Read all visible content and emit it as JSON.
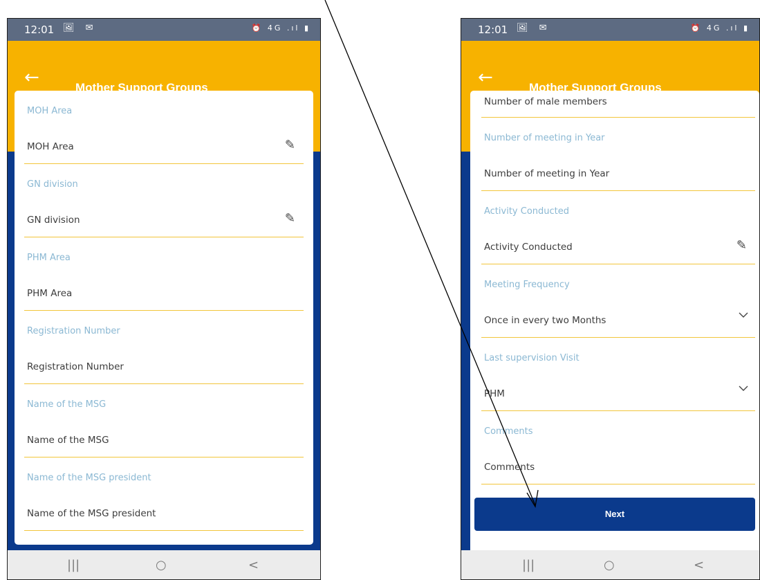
{
  "status": {
    "time": "12:01",
    "icons": "🖼 ✉",
    "sys": "⏰ 4G .ıl ▮"
  },
  "app": {
    "title": "Mother Support Groups",
    "back_glyph": "←"
  },
  "left_fields": [
    {
      "label": "MOH Area",
      "value": "MOH Area",
      "edit": true
    },
    {
      "label": "GN division",
      "value": "GN division",
      "edit": true
    },
    {
      "label": "PHM Area",
      "value": "PHM Area"
    },
    {
      "label": "Registration Number",
      "value": "Registration Number"
    },
    {
      "label": "Name of the MSG",
      "value": "Name of the MSG"
    },
    {
      "label": "Name of the MSG president",
      "value": "Name of the MSG president"
    }
  ],
  "right_fields": {
    "top_value": "Number of male members",
    "items": [
      {
        "label": "Number of meeting in Year",
        "value": "Number of meeting in Year"
      },
      {
        "label": "Activity Conducted",
        "value": "Activity Conducted",
        "edit": true
      },
      {
        "label": "Meeting Frequency",
        "value": "Once in every two Months",
        "dropdown": true
      },
      {
        "label": "Last supervision Visit",
        "value": "PHM",
        "dropdown": true
      },
      {
        "label": "Comments",
        "value": "Comments"
      }
    ]
  },
  "next_label": "Next",
  "nav": {
    "recent": "|||",
    "home": "○",
    "back": "<"
  },
  "colors": {
    "accent": "#f7b200",
    "primary": "#0b3a8c",
    "label": "#8bb8d3"
  }
}
